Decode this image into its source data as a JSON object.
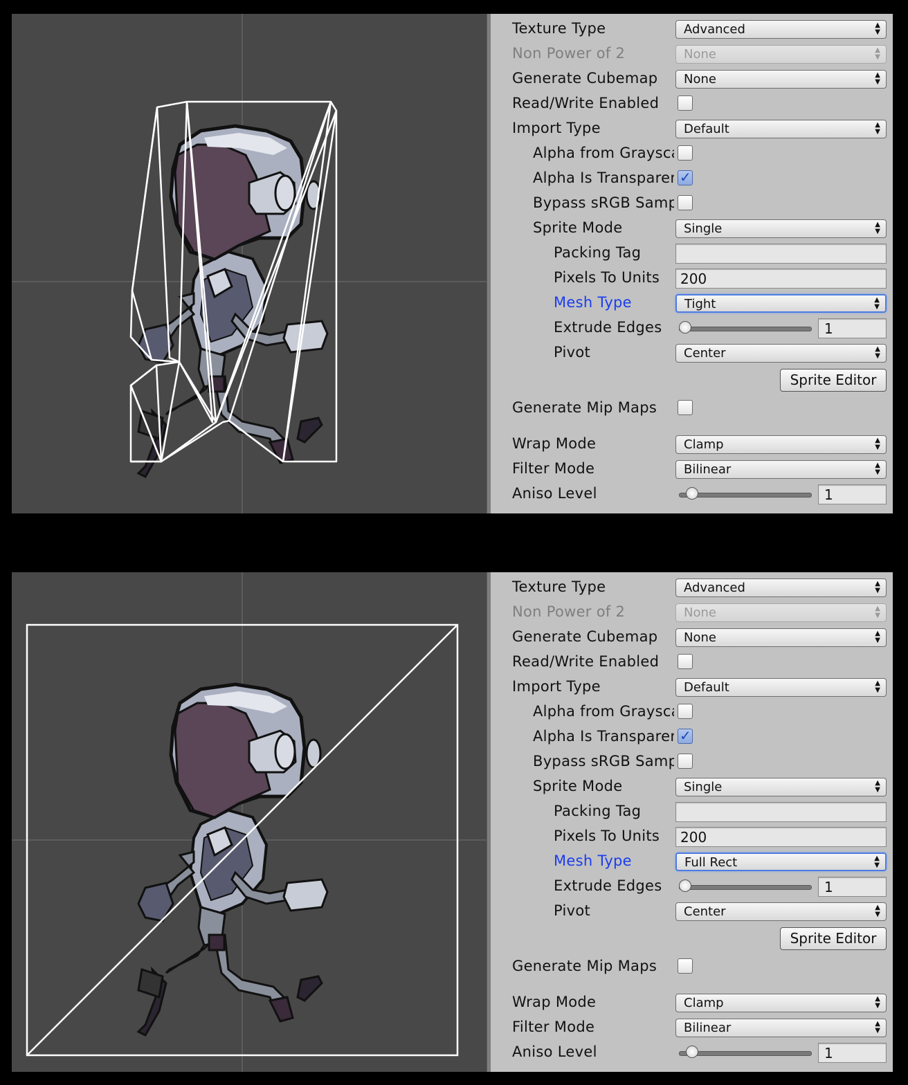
{
  "inspector_labels": {
    "texture_type": "Texture Type",
    "non_power_of_2": "Non Power of 2",
    "generate_cubemap": "Generate Cubemap",
    "read_write_enabled": "Read/Write Enabled",
    "import_type": "Import Type",
    "alpha_from_grayscale": "Alpha from Grayscale",
    "alpha_is_transparency": "Alpha Is Transparency",
    "bypass_srgb": "Bypass sRGB Sampling",
    "sprite_mode": "Sprite Mode",
    "packing_tag": "Packing Tag",
    "pixels_to_units": "Pixels To Units",
    "mesh_type": "Mesh Type",
    "extrude_edges": "Extrude Edges",
    "pivot": "Pivot",
    "sprite_editor": "Sprite Editor",
    "generate_mip_maps": "Generate Mip Maps",
    "wrap_mode": "Wrap Mode",
    "filter_mode": "Filter Mode",
    "aniso_level": "Aniso Level"
  },
  "panels": [
    {
      "texture_type": "Advanced",
      "non_power_of_2": "None",
      "generate_cubemap": "None",
      "read_write_enabled": false,
      "import_type": "Default",
      "alpha_from_grayscale": false,
      "alpha_is_transparency": true,
      "bypass_srgb": false,
      "sprite_mode": "Single",
      "packing_tag": "",
      "pixels_to_units": "200",
      "mesh_type": "Tight",
      "extrude_edges": "1",
      "extrude_edges_fraction": 0.0,
      "pivot": "Center",
      "generate_mip_maps": false,
      "wrap_mode": "Clamp",
      "filter_mode": "Bilinear",
      "aniso_level": "1",
      "aniso_level_fraction": 0.06
    },
    {
      "texture_type": "Advanced",
      "non_power_of_2": "None",
      "generate_cubemap": "None",
      "read_write_enabled": false,
      "import_type": "Default",
      "alpha_from_grayscale": false,
      "alpha_is_transparency": true,
      "bypass_srgb": false,
      "sprite_mode": "Single",
      "packing_tag": "",
      "pixels_to_units": "200",
      "mesh_type": "Full Rect",
      "extrude_edges": "1",
      "extrude_edges_fraction": 0.0,
      "pivot": "Center",
      "generate_mip_maps": false,
      "wrap_mode": "Clamp",
      "filter_mode": "Bilinear",
      "aniso_level": "1",
      "aniso_level_fraction": 0.06
    }
  ],
  "colors": {
    "viewport_bg": "#484848",
    "inspector_bg": "#c2c2c2",
    "mesh_wire": "#ffffff",
    "highlight_label": "#1a3cf0",
    "robot_visor": "#5a4657",
    "robot_body": "#aab0c0"
  }
}
